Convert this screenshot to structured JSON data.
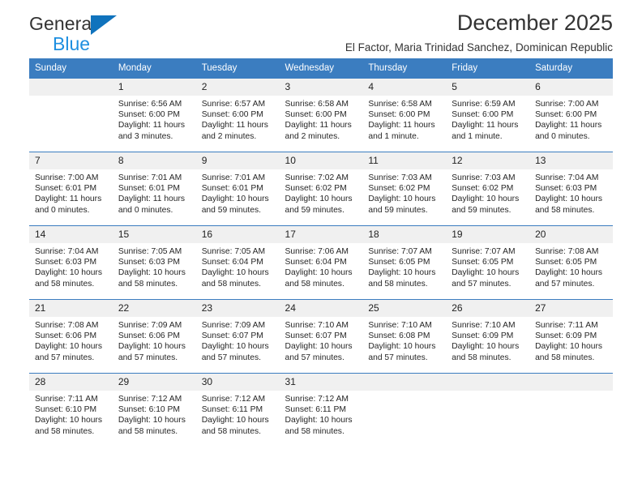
{
  "brand": {
    "name_line1": "General",
    "name_line2": "Blue",
    "triangle_color": "#1073BD",
    "blue_text_color": "#1E8FE0"
  },
  "header": {
    "title": "December 2025",
    "subtitle": "El Factor, Maria Trinidad Sanchez, Dominican Republic",
    "header_bg": "#3B7DC0",
    "daynum_bg": "#F0F0F0"
  },
  "columns": [
    "Sunday",
    "Monday",
    "Tuesday",
    "Wednesday",
    "Thursday",
    "Friday",
    "Saturday"
  ],
  "weeks": [
    [
      {
        "day": "",
        "empty": true,
        "sunrise": "",
        "sunset": "",
        "daylight_line1": "",
        "daylight_line2": ""
      },
      {
        "day": "1",
        "sunrise": "Sunrise: 6:56 AM",
        "sunset": "Sunset: 6:00 PM",
        "daylight_line1": "Daylight: 11 hours",
        "daylight_line2": "and 3 minutes."
      },
      {
        "day": "2",
        "sunrise": "Sunrise: 6:57 AM",
        "sunset": "Sunset: 6:00 PM",
        "daylight_line1": "Daylight: 11 hours",
        "daylight_line2": "and 2 minutes."
      },
      {
        "day": "3",
        "sunrise": "Sunrise: 6:58 AM",
        "sunset": "Sunset: 6:00 PM",
        "daylight_line1": "Daylight: 11 hours",
        "daylight_line2": "and 2 minutes."
      },
      {
        "day": "4",
        "sunrise": "Sunrise: 6:58 AM",
        "sunset": "Sunset: 6:00 PM",
        "daylight_line1": "Daylight: 11 hours",
        "daylight_line2": "and 1 minute."
      },
      {
        "day": "5",
        "sunrise": "Sunrise: 6:59 AM",
        "sunset": "Sunset: 6:00 PM",
        "daylight_line1": "Daylight: 11 hours",
        "daylight_line2": "and 1 minute."
      },
      {
        "day": "6",
        "sunrise": "Sunrise: 7:00 AM",
        "sunset": "Sunset: 6:00 PM",
        "daylight_line1": "Daylight: 11 hours",
        "daylight_line2": "and 0 minutes."
      }
    ],
    [
      {
        "day": "7",
        "sunrise": "Sunrise: 7:00 AM",
        "sunset": "Sunset: 6:01 PM",
        "daylight_line1": "Daylight: 11 hours",
        "daylight_line2": "and 0 minutes."
      },
      {
        "day": "8",
        "sunrise": "Sunrise: 7:01 AM",
        "sunset": "Sunset: 6:01 PM",
        "daylight_line1": "Daylight: 11 hours",
        "daylight_line2": "and 0 minutes."
      },
      {
        "day": "9",
        "sunrise": "Sunrise: 7:01 AM",
        "sunset": "Sunset: 6:01 PM",
        "daylight_line1": "Daylight: 10 hours",
        "daylight_line2": "and 59 minutes."
      },
      {
        "day": "10",
        "sunrise": "Sunrise: 7:02 AM",
        "sunset": "Sunset: 6:02 PM",
        "daylight_line1": "Daylight: 10 hours",
        "daylight_line2": "and 59 minutes."
      },
      {
        "day": "11",
        "sunrise": "Sunrise: 7:03 AM",
        "sunset": "Sunset: 6:02 PM",
        "daylight_line1": "Daylight: 10 hours",
        "daylight_line2": "and 59 minutes."
      },
      {
        "day": "12",
        "sunrise": "Sunrise: 7:03 AM",
        "sunset": "Sunset: 6:02 PM",
        "daylight_line1": "Daylight: 10 hours",
        "daylight_line2": "and 59 minutes."
      },
      {
        "day": "13",
        "sunrise": "Sunrise: 7:04 AM",
        "sunset": "Sunset: 6:03 PM",
        "daylight_line1": "Daylight: 10 hours",
        "daylight_line2": "and 58 minutes."
      }
    ],
    [
      {
        "day": "14",
        "sunrise": "Sunrise: 7:04 AM",
        "sunset": "Sunset: 6:03 PM",
        "daylight_line1": "Daylight: 10 hours",
        "daylight_line2": "and 58 minutes."
      },
      {
        "day": "15",
        "sunrise": "Sunrise: 7:05 AM",
        "sunset": "Sunset: 6:03 PM",
        "daylight_line1": "Daylight: 10 hours",
        "daylight_line2": "and 58 minutes."
      },
      {
        "day": "16",
        "sunrise": "Sunrise: 7:05 AM",
        "sunset": "Sunset: 6:04 PM",
        "daylight_line1": "Daylight: 10 hours",
        "daylight_line2": "and 58 minutes."
      },
      {
        "day": "17",
        "sunrise": "Sunrise: 7:06 AM",
        "sunset": "Sunset: 6:04 PM",
        "daylight_line1": "Daylight: 10 hours",
        "daylight_line2": "and 58 minutes."
      },
      {
        "day": "18",
        "sunrise": "Sunrise: 7:07 AM",
        "sunset": "Sunset: 6:05 PM",
        "daylight_line1": "Daylight: 10 hours",
        "daylight_line2": "and 58 minutes."
      },
      {
        "day": "19",
        "sunrise": "Sunrise: 7:07 AM",
        "sunset": "Sunset: 6:05 PM",
        "daylight_line1": "Daylight: 10 hours",
        "daylight_line2": "and 57 minutes."
      },
      {
        "day": "20",
        "sunrise": "Sunrise: 7:08 AM",
        "sunset": "Sunset: 6:05 PM",
        "daylight_line1": "Daylight: 10 hours",
        "daylight_line2": "and 57 minutes."
      }
    ],
    [
      {
        "day": "21",
        "sunrise": "Sunrise: 7:08 AM",
        "sunset": "Sunset: 6:06 PM",
        "daylight_line1": "Daylight: 10 hours",
        "daylight_line2": "and 57 minutes."
      },
      {
        "day": "22",
        "sunrise": "Sunrise: 7:09 AM",
        "sunset": "Sunset: 6:06 PM",
        "daylight_line1": "Daylight: 10 hours",
        "daylight_line2": "and 57 minutes."
      },
      {
        "day": "23",
        "sunrise": "Sunrise: 7:09 AM",
        "sunset": "Sunset: 6:07 PM",
        "daylight_line1": "Daylight: 10 hours",
        "daylight_line2": "and 57 minutes."
      },
      {
        "day": "24",
        "sunrise": "Sunrise: 7:10 AM",
        "sunset": "Sunset: 6:07 PM",
        "daylight_line1": "Daylight: 10 hours",
        "daylight_line2": "and 57 minutes."
      },
      {
        "day": "25",
        "sunrise": "Sunrise: 7:10 AM",
        "sunset": "Sunset: 6:08 PM",
        "daylight_line1": "Daylight: 10 hours",
        "daylight_line2": "and 57 minutes."
      },
      {
        "day": "26",
        "sunrise": "Sunrise: 7:10 AM",
        "sunset": "Sunset: 6:09 PM",
        "daylight_line1": "Daylight: 10 hours",
        "daylight_line2": "and 58 minutes."
      },
      {
        "day": "27",
        "sunrise": "Sunrise: 7:11 AM",
        "sunset": "Sunset: 6:09 PM",
        "daylight_line1": "Daylight: 10 hours",
        "daylight_line2": "and 58 minutes."
      }
    ],
    [
      {
        "day": "28",
        "sunrise": "Sunrise: 7:11 AM",
        "sunset": "Sunset: 6:10 PM",
        "daylight_line1": "Daylight: 10 hours",
        "daylight_line2": "and 58 minutes."
      },
      {
        "day": "29",
        "sunrise": "Sunrise: 7:12 AM",
        "sunset": "Sunset: 6:10 PM",
        "daylight_line1": "Daylight: 10 hours",
        "daylight_line2": "and 58 minutes."
      },
      {
        "day": "30",
        "sunrise": "Sunrise: 7:12 AM",
        "sunset": "Sunset: 6:11 PM",
        "daylight_line1": "Daylight: 10 hours",
        "daylight_line2": "and 58 minutes."
      },
      {
        "day": "31",
        "sunrise": "Sunrise: 7:12 AM",
        "sunset": "Sunset: 6:11 PM",
        "daylight_line1": "Daylight: 10 hours",
        "daylight_line2": "and 58 minutes."
      },
      {
        "day": "",
        "empty": true,
        "sunrise": "",
        "sunset": "",
        "daylight_line1": "",
        "daylight_line2": ""
      },
      {
        "day": "",
        "empty": true,
        "sunrise": "",
        "sunset": "",
        "daylight_line1": "",
        "daylight_line2": ""
      },
      {
        "day": "",
        "empty": true,
        "sunrise": "",
        "sunset": "",
        "daylight_line1": "",
        "daylight_line2": ""
      }
    ]
  ]
}
